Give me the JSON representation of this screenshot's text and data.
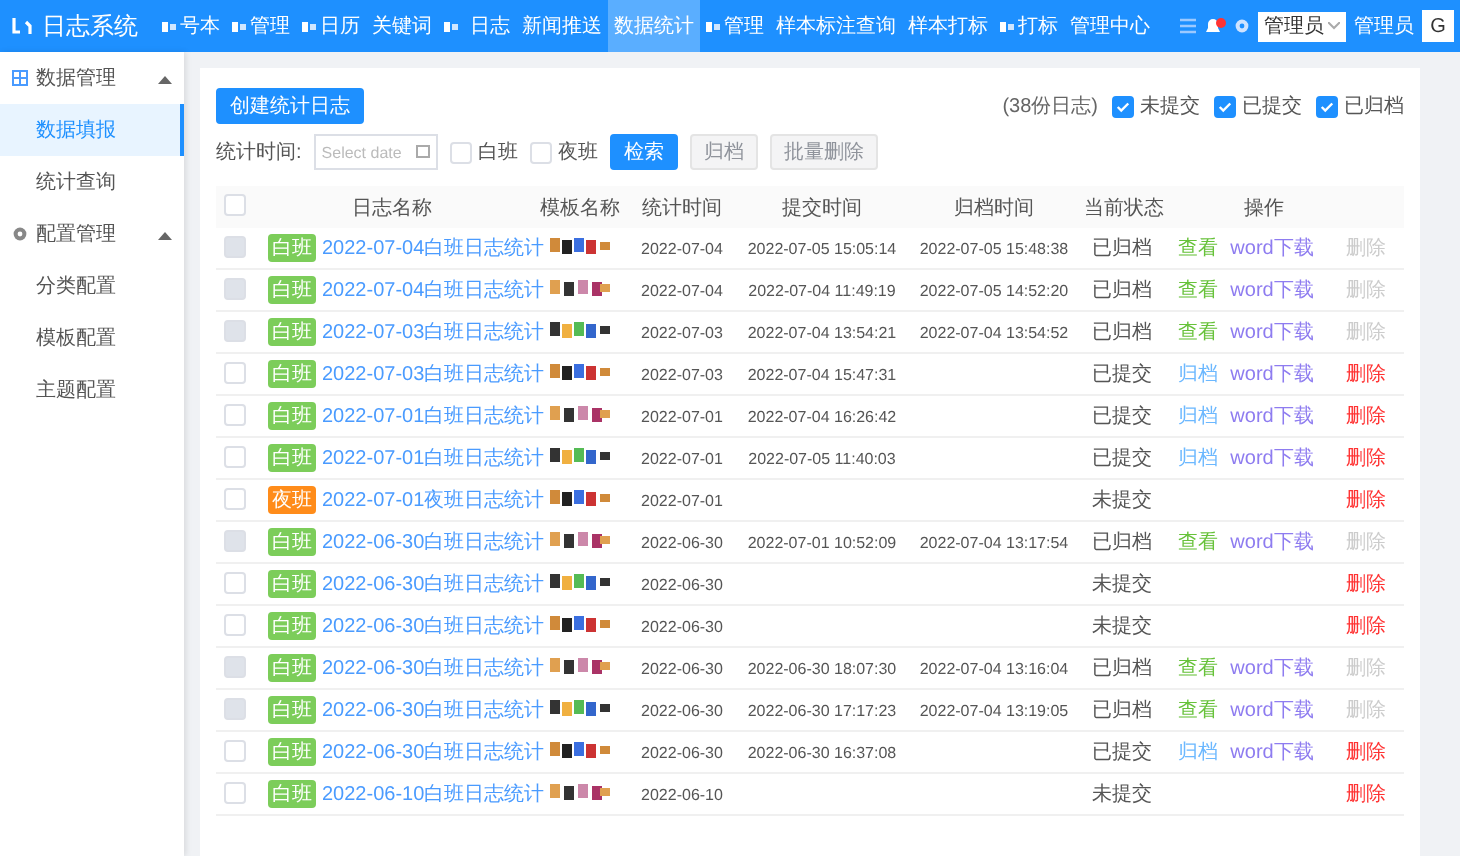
{
  "logo": "日志系统",
  "nav": [
    {
      "label": "号本",
      "icon": true,
      "selected": false
    },
    {
      "label": "管理",
      "icon": true,
      "selected": false
    },
    {
      "label": "日历",
      "icon": true,
      "selected": false
    },
    {
      "label": "关键词",
      "icon": false,
      "selected": false
    },
    {
      "icon": true,
      "selected": false
    },
    {
      "label": "日志",
      "icon": false,
      "selected": false
    },
    {
      "label": "新闻推送",
      "icon": false,
      "selected": false
    },
    {
      "label": "数据统计",
      "icon": false,
      "selected": true
    },
    {
      "label": "管理",
      "icon": true,
      "selected": false
    },
    {
      "label": "样本标注查询",
      "icon": false,
      "selected": false
    },
    {
      "label": "样本打标",
      "icon": false,
      "selected": false
    },
    {
      "label": "打标",
      "icon": true,
      "selected": false
    },
    {
      "label": "管理中心",
      "icon": false,
      "selected": false
    }
  ],
  "header_right": {
    "notification_badge": true,
    "role_select": "管理员",
    "user": "管理员",
    "avatar": "G"
  },
  "sidebar": [
    {
      "label": "数据管理",
      "expanded": true,
      "children": [
        {
          "label": "数据填报",
          "selected": true
        },
        {
          "label": "统计查询",
          "selected": false
        }
      ]
    },
    {
      "label": "配置管理",
      "expanded": true,
      "children": [
        {
          "label": "分类配置",
          "selected": false
        },
        {
          "label": "模板配置",
          "selected": false
        },
        {
          "label": "主题配置",
          "selected": false
        }
      ]
    }
  ],
  "create_button": "创建统计日志",
  "count": "(38份日志)",
  "status_filters": [
    {
      "label": "未提交",
      "checked": true
    },
    {
      "label": "已提交",
      "checked": true
    },
    {
      "label": "已归档",
      "checked": true
    }
  ],
  "filter": {
    "label": "统计时间:",
    "date_placeholder": "Select date",
    "shifts": [
      {
        "label": "白班",
        "checked": false
      },
      {
        "label": "夜班",
        "checked": false
      }
    ],
    "buttons": [
      {
        "label": "检索",
        "disabled": false
      },
      {
        "label": "归档",
        "disabled": true
      },
      {
        "label": "批量删除",
        "disabled": true
      }
    ]
  },
  "table": {
    "select_all": {
      "checked": false
    },
    "columns": [
      "日志名称",
      "模板名称",
      "统计时间",
      "提交时间",
      "归档时间",
      "当前状态",
      "操作"
    ],
    "rows": [
      {
        "disabled": true,
        "tag": {
          "label": "白班",
          "kind": "day"
        },
        "name": "2022-07-04白班日志统计",
        "date": "2022-07-04",
        "submitted": "2022-07-05 15:05:14",
        "archived": "2022-07-05 15:48:38",
        "status": "已归档",
        "actions": [
          {
            "label": "查看",
            "kind": "view"
          },
          {
            "label": "word下载",
            "kind": "download"
          }
        ],
        "delete": {
          "label": "删除",
          "disabled": true
        }
      },
      {
        "disabled": true,
        "tag": {
          "label": "白班",
          "kind": "day"
        },
        "name": "2022-07-04白班日志统计",
        "date": "2022-07-04",
        "submitted": "2022-07-04 11:49:19",
        "archived": "2022-07-05 14:52:20",
        "status": "已归档",
        "actions": [
          {
            "label": "查看",
            "kind": "view"
          },
          {
            "label": "word下载",
            "kind": "download"
          }
        ],
        "delete": {
          "label": "删除",
          "disabled": true
        }
      },
      {
        "disabled": true,
        "tag": {
          "label": "白班",
          "kind": "day"
        },
        "name": "2022-07-03白班日志统计",
        "date": "2022-07-03",
        "submitted": "2022-07-04 13:54:21",
        "archived": "2022-07-04 13:54:52",
        "status": "已归档",
        "actions": [
          {
            "label": "查看",
            "kind": "view"
          },
          {
            "label": "word下载",
            "kind": "download"
          }
        ],
        "delete": {
          "label": "删除",
          "disabled": true
        }
      },
      {
        "disabled": false,
        "tag": {
          "label": "白班",
          "kind": "day"
        },
        "name": "2022-07-03白班日志统计",
        "date": "2022-07-03",
        "submitted": "2022-07-04 15:47:31",
        "status": "已提交",
        "actions": [
          {
            "label": "归档",
            "kind": "archive"
          },
          {
            "label": "word下载",
            "kind": "download"
          }
        ],
        "delete": {
          "label": "删除",
          "disabled": false
        }
      },
      {
        "disabled": false,
        "tag": {
          "label": "白班",
          "kind": "day"
        },
        "name": "2022-07-01白班日志统计",
        "date": "2022-07-01",
        "submitted": "2022-07-04 16:26:42",
        "status": "已提交",
        "actions": [
          {
            "label": "归档",
            "kind": "archive"
          },
          {
            "label": "word下载",
            "kind": "download"
          }
        ],
        "delete": {
          "label": "删除",
          "disabled": false
        }
      },
      {
        "disabled": false,
        "tag": {
          "label": "白班",
          "kind": "day"
        },
        "name": "2022-07-01白班日志统计",
        "date": "2022-07-01",
        "submitted": "2022-07-05 11:40:03",
        "status": "已提交",
        "actions": [
          {
            "label": "归档",
            "kind": "archive"
          },
          {
            "label": "word下载",
            "kind": "download"
          }
        ],
        "delete": {
          "label": "删除",
          "disabled": false
        }
      },
      {
        "disabled": false,
        "tag": {
          "label": "夜班",
          "kind": "night"
        },
        "name": "2022-07-01夜班日志统计",
        "date": "2022-07-01",
        "status": "未提交",
        "delete": {
          "label": "删除",
          "disabled": false
        }
      },
      {
        "disabled": true,
        "tag": {
          "label": "白班",
          "kind": "day"
        },
        "name": "2022-06-30白班日志统计",
        "date": "2022-06-30",
        "submitted": "2022-07-01 10:52:09",
        "archived": "2022-07-04 13:17:54",
        "status": "已归档",
        "actions": [
          {
            "label": "查看",
            "kind": "view"
          },
          {
            "label": "word下载",
            "kind": "download"
          }
        ],
        "delete": {
          "label": "删除",
          "disabled": true
        }
      },
      {
        "disabled": false,
        "tag": {
          "label": "白班",
          "kind": "day"
        },
        "name": "2022-06-30白班日志统计",
        "date": "2022-06-30",
        "status": "未提交",
        "delete": {
          "label": "删除",
          "disabled": false
        }
      },
      {
        "disabled": false,
        "tag": {
          "label": "白班",
          "kind": "day"
        },
        "name": "2022-06-30白班日志统计",
        "date": "2022-06-30",
        "status": "未提交",
        "delete": {
          "label": "删除",
          "disabled": false
        }
      },
      {
        "disabled": true,
        "tag": {
          "label": "白班",
          "kind": "day"
        },
        "name": "2022-06-30白班日志统计",
        "date": "2022-06-30",
        "submitted": "2022-06-30 18:07:30",
        "archived": "2022-07-04 13:16:04",
        "status": "已归档",
        "actions": [
          {
            "label": "查看",
            "kind": "view"
          },
          {
            "label": "word下载",
            "kind": "download"
          }
        ],
        "delete": {
          "label": "删除",
          "disabled": true
        }
      },
      {
        "disabled": true,
        "tag": {
          "label": "白班",
          "kind": "day"
        },
        "name": "2022-06-30白班日志统计",
        "date": "2022-06-30",
        "submitted": "2022-06-30 17:17:23",
        "archived": "2022-07-04 13:19:05",
        "status": "已归档",
        "actions": [
          {
            "label": "查看",
            "kind": "view"
          },
          {
            "label": "word下载",
            "kind": "download"
          }
        ],
        "delete": {
          "label": "删除",
          "disabled": true
        }
      },
      {
        "disabled": false,
        "tag": {
          "label": "白班",
          "kind": "day"
        },
        "name": "2022-06-30白班日志统计",
        "date": "2022-06-30",
        "submitted": "2022-06-30 16:37:08",
        "status": "已提交",
        "actions": [
          {
            "label": "归档",
            "kind": "archive"
          },
          {
            "label": "word下载",
            "kind": "download"
          }
        ],
        "delete": {
          "label": "删除",
          "disabled": false
        }
      },
      {
        "disabled": false,
        "tag": {
          "label": "白班",
          "kind": "day"
        },
        "name": "2022-06-10白班日志统计",
        "date": "2022-06-10",
        "status": "未提交",
        "delete": {
          "label": "删除",
          "disabled": false
        }
      }
    ]
  }
}
